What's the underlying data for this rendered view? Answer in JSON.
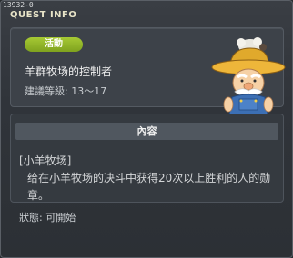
{
  "window": {
    "quest_id": "13932-0",
    "title": "QUEST INFO"
  },
  "quest": {
    "badge": "活動",
    "name": "羊群牧场的控制者",
    "level": "建議等級: 13～17"
  },
  "content": {
    "header": "內容",
    "section_label": "[小羊牧场]",
    "description": "给在小羊牧场的决斗中获得20次以上胜利的人的勋章。"
  },
  "status": "狀態: 可開始",
  "colors": {
    "badge_green": "#8fb526",
    "background": "#30343a",
    "panel": "#3d4249"
  },
  "icons": {
    "npc": "farmer-npc-with-sheep-hat"
  }
}
